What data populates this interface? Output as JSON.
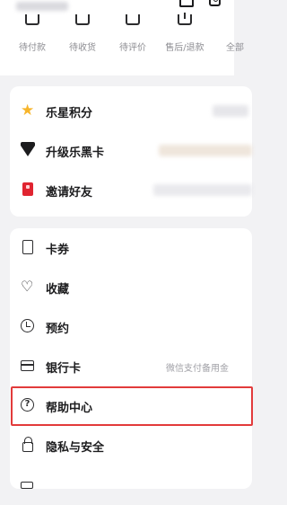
{
  "orders": {
    "items": [
      {
        "label": "待付款"
      },
      {
        "label": "待收货"
      },
      {
        "label": "待评价"
      },
      {
        "label": "售后/退款"
      },
      {
        "label": "全部"
      }
    ]
  },
  "benefits": {
    "items": [
      {
        "label": "乐星积分",
        "icon": "star-icon"
      },
      {
        "label": "升级乐黑卡",
        "icon": "diamond-icon"
      },
      {
        "label": "邀请好友",
        "icon": "red-envelope-icon"
      }
    ]
  },
  "services": {
    "items": [
      {
        "label": "卡券",
        "icon": "coupon-icon"
      },
      {
        "label": "收藏",
        "icon": "heart-icon"
      },
      {
        "label": "预约",
        "icon": "clock-icon"
      },
      {
        "label": "银行卡",
        "icon": "bank-card-icon",
        "note": "微信支付备用金"
      },
      {
        "label": "帮助中心",
        "icon": "help-icon",
        "highlighted": true
      },
      {
        "label": "隐私与安全",
        "icon": "lock-icon"
      }
    ]
  },
  "colors": {
    "highlight": "#e23b3b",
    "star": "#f7b52b",
    "invite": "#e02430"
  }
}
